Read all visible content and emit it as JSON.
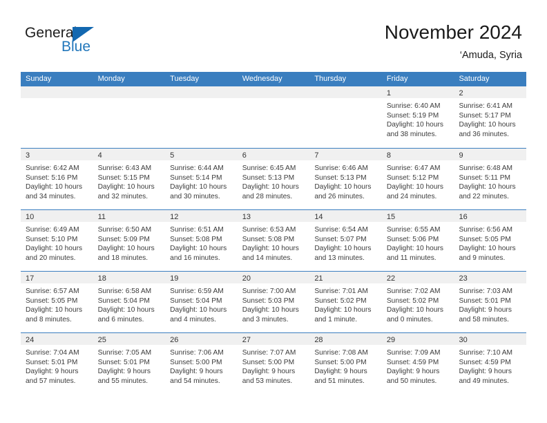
{
  "brand": {
    "name_primary": "General",
    "name_secondary": "Blue",
    "accent_color": "#1368b0",
    "secondary_color": "#2277bb"
  },
  "header": {
    "month_title": "November 2024",
    "location": "‘Amuda, Syria"
  },
  "calendar": {
    "header_bg": "#3a7ebf",
    "daynum_band_bg": "#f0f0f0",
    "weekday_headers": [
      "Sunday",
      "Monday",
      "Tuesday",
      "Wednesday",
      "Thursday",
      "Friday",
      "Saturday"
    ],
    "weeks": [
      [
        {
          "day": "",
          "lines": []
        },
        {
          "day": "",
          "lines": []
        },
        {
          "day": "",
          "lines": []
        },
        {
          "day": "",
          "lines": []
        },
        {
          "day": "",
          "lines": []
        },
        {
          "day": "1",
          "lines": [
            "Sunrise: 6:40 AM",
            "Sunset: 5:19 PM",
            "Daylight: 10 hours",
            "and 38 minutes."
          ]
        },
        {
          "day": "2",
          "lines": [
            "Sunrise: 6:41 AM",
            "Sunset: 5:17 PM",
            "Daylight: 10 hours",
            "and 36 minutes."
          ]
        }
      ],
      [
        {
          "day": "3",
          "lines": [
            "Sunrise: 6:42 AM",
            "Sunset: 5:16 PM",
            "Daylight: 10 hours",
            "and 34 minutes."
          ]
        },
        {
          "day": "4",
          "lines": [
            "Sunrise: 6:43 AM",
            "Sunset: 5:15 PM",
            "Daylight: 10 hours",
            "and 32 minutes."
          ]
        },
        {
          "day": "5",
          "lines": [
            "Sunrise: 6:44 AM",
            "Sunset: 5:14 PM",
            "Daylight: 10 hours",
            "and 30 minutes."
          ]
        },
        {
          "day": "6",
          "lines": [
            "Sunrise: 6:45 AM",
            "Sunset: 5:13 PM",
            "Daylight: 10 hours",
            "and 28 minutes."
          ]
        },
        {
          "day": "7",
          "lines": [
            "Sunrise: 6:46 AM",
            "Sunset: 5:13 PM",
            "Daylight: 10 hours",
            "and 26 minutes."
          ]
        },
        {
          "day": "8",
          "lines": [
            "Sunrise: 6:47 AM",
            "Sunset: 5:12 PM",
            "Daylight: 10 hours",
            "and 24 minutes."
          ]
        },
        {
          "day": "9",
          "lines": [
            "Sunrise: 6:48 AM",
            "Sunset: 5:11 PM",
            "Daylight: 10 hours",
            "and 22 minutes."
          ]
        }
      ],
      [
        {
          "day": "10",
          "lines": [
            "Sunrise: 6:49 AM",
            "Sunset: 5:10 PM",
            "Daylight: 10 hours",
            "and 20 minutes."
          ]
        },
        {
          "day": "11",
          "lines": [
            "Sunrise: 6:50 AM",
            "Sunset: 5:09 PM",
            "Daylight: 10 hours",
            "and 18 minutes."
          ]
        },
        {
          "day": "12",
          "lines": [
            "Sunrise: 6:51 AM",
            "Sunset: 5:08 PM",
            "Daylight: 10 hours",
            "and 16 minutes."
          ]
        },
        {
          "day": "13",
          "lines": [
            "Sunrise: 6:53 AM",
            "Sunset: 5:08 PM",
            "Daylight: 10 hours",
            "and 14 minutes."
          ]
        },
        {
          "day": "14",
          "lines": [
            "Sunrise: 6:54 AM",
            "Sunset: 5:07 PM",
            "Daylight: 10 hours",
            "and 13 minutes."
          ]
        },
        {
          "day": "15",
          "lines": [
            "Sunrise: 6:55 AM",
            "Sunset: 5:06 PM",
            "Daylight: 10 hours",
            "and 11 minutes."
          ]
        },
        {
          "day": "16",
          "lines": [
            "Sunrise: 6:56 AM",
            "Sunset: 5:05 PM",
            "Daylight: 10 hours",
            "and 9 minutes."
          ]
        }
      ],
      [
        {
          "day": "17",
          "lines": [
            "Sunrise: 6:57 AM",
            "Sunset: 5:05 PM",
            "Daylight: 10 hours",
            "and 8 minutes."
          ]
        },
        {
          "day": "18",
          "lines": [
            "Sunrise: 6:58 AM",
            "Sunset: 5:04 PM",
            "Daylight: 10 hours",
            "and 6 minutes."
          ]
        },
        {
          "day": "19",
          "lines": [
            "Sunrise: 6:59 AM",
            "Sunset: 5:04 PM",
            "Daylight: 10 hours",
            "and 4 minutes."
          ]
        },
        {
          "day": "20",
          "lines": [
            "Sunrise: 7:00 AM",
            "Sunset: 5:03 PM",
            "Daylight: 10 hours",
            "and 3 minutes."
          ]
        },
        {
          "day": "21",
          "lines": [
            "Sunrise: 7:01 AM",
            "Sunset: 5:02 PM",
            "Daylight: 10 hours",
            "and 1 minute."
          ]
        },
        {
          "day": "22",
          "lines": [
            "Sunrise: 7:02 AM",
            "Sunset: 5:02 PM",
            "Daylight: 10 hours",
            "and 0 minutes."
          ]
        },
        {
          "day": "23",
          "lines": [
            "Sunrise: 7:03 AM",
            "Sunset: 5:01 PM",
            "Daylight: 9 hours",
            "and 58 minutes."
          ]
        }
      ],
      [
        {
          "day": "24",
          "lines": [
            "Sunrise: 7:04 AM",
            "Sunset: 5:01 PM",
            "Daylight: 9 hours",
            "and 57 minutes."
          ]
        },
        {
          "day": "25",
          "lines": [
            "Sunrise: 7:05 AM",
            "Sunset: 5:01 PM",
            "Daylight: 9 hours",
            "and 55 minutes."
          ]
        },
        {
          "day": "26",
          "lines": [
            "Sunrise: 7:06 AM",
            "Sunset: 5:00 PM",
            "Daylight: 9 hours",
            "and 54 minutes."
          ]
        },
        {
          "day": "27",
          "lines": [
            "Sunrise: 7:07 AM",
            "Sunset: 5:00 PM",
            "Daylight: 9 hours",
            "and 53 minutes."
          ]
        },
        {
          "day": "28",
          "lines": [
            "Sunrise: 7:08 AM",
            "Sunset: 5:00 PM",
            "Daylight: 9 hours",
            "and 51 minutes."
          ]
        },
        {
          "day": "29",
          "lines": [
            "Sunrise: 7:09 AM",
            "Sunset: 4:59 PM",
            "Daylight: 9 hours",
            "and 50 minutes."
          ]
        },
        {
          "day": "30",
          "lines": [
            "Sunrise: 7:10 AM",
            "Sunset: 4:59 PM",
            "Daylight: 9 hours",
            "and 49 minutes."
          ]
        }
      ]
    ]
  }
}
